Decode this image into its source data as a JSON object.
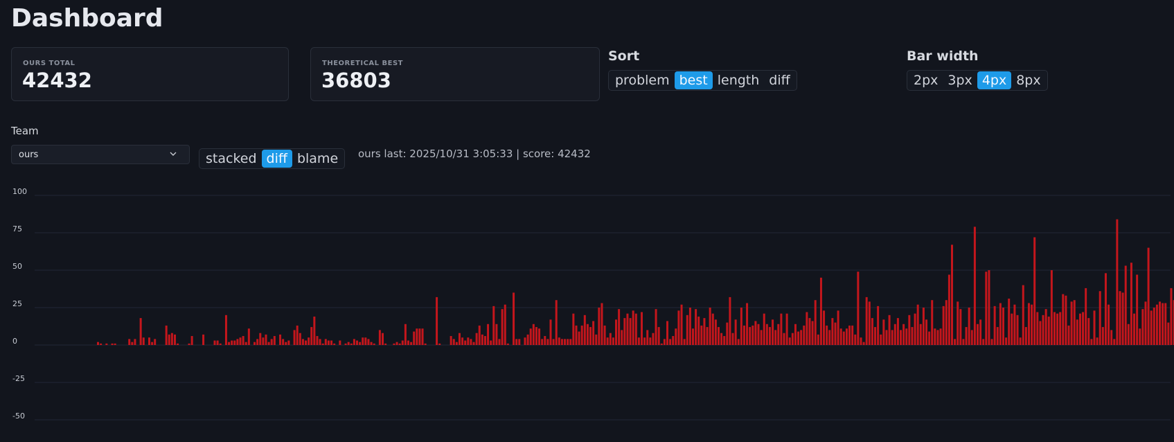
{
  "header": {
    "title": "Dashboard"
  },
  "cards": [
    {
      "label": "OURS TOTAL",
      "value": "42432"
    },
    {
      "label": "THEORETICAL BEST",
      "value": "36803"
    }
  ],
  "sort": {
    "heading": "Sort",
    "options": [
      "problem",
      "best",
      "length",
      "diff"
    ],
    "selected": "best"
  },
  "bar_width": {
    "heading": "Bar width",
    "options": [
      "2px",
      "3px",
      "4px",
      "8px"
    ],
    "selected": "4px"
  },
  "team": {
    "label": "Team",
    "value": "ours"
  },
  "mode": {
    "options": [
      "stacked",
      "diff",
      "blame"
    ],
    "selected": "diff"
  },
  "status": "ours last: 2025/10/31 3:05:33 | score: 42432",
  "colors": {
    "background": "#12151d",
    "accent": "#1e9be9",
    "bar": "#c4161c",
    "grid": "#232836"
  },
  "chart_data": {
    "type": "bar",
    "title": "",
    "xlabel": "",
    "ylabel": "",
    "ylim": [
      -60,
      100
    ],
    "yticks": [
      100,
      75,
      50,
      25,
      0,
      -25,
      -50
    ],
    "grid": true,
    "series": [
      {
        "values": [
          2,
          1,
          0,
          1,
          0,
          1,
          1,
          0,
          0,
          0,
          0,
          4,
          2,
          4,
          0,
          18,
          5,
          0,
          5,
          2,
          4,
          0,
          0,
          0,
          13,
          7,
          8,
          7,
          1,
          0,
          0,
          0,
          1,
          6,
          0,
          0,
          0,
          7,
          0,
          0,
          0,
          3,
          3,
          1,
          0,
          20,
          2,
          3,
          3,
          4,
          5,
          6,
          2,
          11,
          0,
          2,
          4,
          8,
          5,
          7,
          2,
          4,
          6,
          0,
          7,
          4,
          2,
          3,
          0,
          10,
          13,
          8,
          4,
          3,
          5,
          12,
          19,
          6,
          4,
          1,
          4,
          3,
          3,
          1,
          0,
          3,
          0,
          1,
          2,
          1,
          4,
          3,
          2,
          5,
          5,
          4,
          2,
          1,
          0,
          10,
          8,
          1,
          0,
          0,
          1,
          2,
          1,
          3,
          14,
          3,
          2,
          9,
          11,
          11,
          11,
          1,
          0,
          0,
          0,
          32,
          1,
          0,
          0,
          0,
          6,
          4,
          2,
          8,
          5,
          3,
          5,
          4,
          2,
          8,
          13,
          7,
          6,
          14,
          3,
          26,
          14,
          4,
          24,
          27,
          1,
          0,
          35,
          4,
          4,
          0,
          5,
          7,
          11,
          14,
          12,
          11,
          4,
          6,
          4,
          17,
          4,
          30,
          5,
          4,
          4,
          4,
          4,
          21,
          13,
          9,
          13,
          20,
          14,
          12,
          16,
          7,
          25,
          28,
          13,
          5,
          8,
          5,
          17,
          24,
          10,
          18,
          21,
          18,
          23,
          21,
          5,
          22,
          5,
          10,
          5,
          8,
          24,
          12,
          1,
          4,
          16,
          4,
          6,
          11,
          23,
          27,
          4,
          20,
          25,
          11,
          24,
          19,
          13,
          18,
          12,
          25,
          21,
          17,
          12,
          8,
          6,
          15,
          32,
          8,
          17,
          4,
          25,
          13,
          28,
          12,
          13,
          16,
          14,
          10,
          21,
          14,
          12,
          17,
          10,
          14,
          21,
          8,
          21,
          5,
          8,
          14,
          9,
          10,
          13,
          22,
          18,
          16,
          30,
          7,
          45,
          23,
          13,
          10,
          18,
          15,
          23,
          11,
          9,
          11,
          13,
          13,
          7,
          49,
          5,
          2,
          32,
          29,
          18,
          12,
          26,
          7,
          17,
          10,
          20,
          10,
          14,
          18,
          10,
          14,
          11,
          20,
          12,
          21,
          27,
          14,
          25,
          17,
          9,
          30,
          11,
          10,
          11,
          26,
          30,
          47,
          67,
          4,
          29,
          24,
          4,
          12,
          25,
          10,
          79,
          14,
          17,
          4,
          49,
          50,
          4,
          26,
          12,
          28,
          25,
          5,
          31,
          21,
          27,
          20,
          5,
          40,
          12,
          28,
          27,
          72,
          22,
          16,
          20,
          24,
          19,
          50,
          22,
          21,
          22,
          34,
          33,
          13,
          29,
          30,
          17,
          21,
          22,
          38,
          18,
          4,
          23,
          5,
          36,
          12,
          48,
          27,
          10,
          4,
          84,
          36,
          35,
          53,
          14,
          55,
          21,
          47,
          11,
          24,
          29,
          65,
          23,
          25,
          27,
          29,
          28,
          28,
          15,
          38,
          30,
          30,
          30,
          4,
          44,
          24,
          13,
          15,
          29,
          17,
          3,
          23,
          20,
          27,
          37,
          30,
          19,
          12,
          11,
          23,
          25,
          29,
          25,
          29,
          1,
          41,
          26,
          22,
          26,
          5,
          33,
          1,
          2,
          41,
          25,
          28,
          25,
          25,
          36,
          23,
          19,
          2,
          33,
          5,
          34,
          46,
          38
        ]
      }
    ]
  }
}
